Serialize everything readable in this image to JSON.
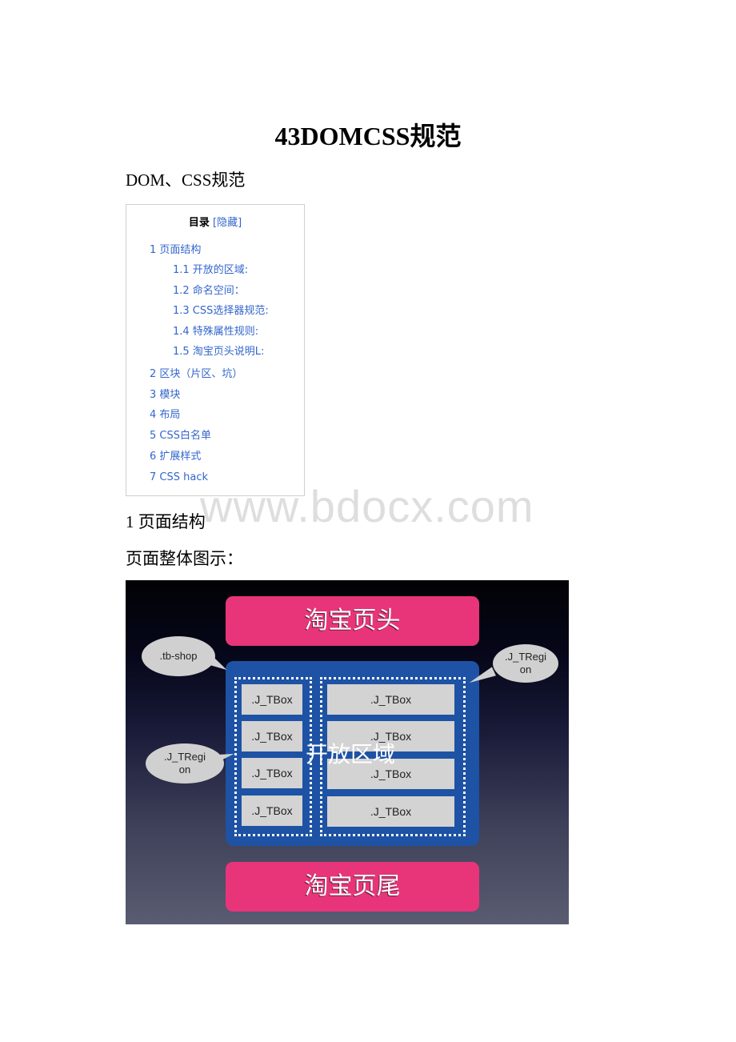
{
  "document": {
    "title": "43DOMCSS规范",
    "subtitle": "DOM、CSS规范"
  },
  "toc": {
    "heading": "目录",
    "toggle_label": "[隐藏]",
    "items": [
      {
        "label": "1 页面结构",
        "level": 1
      },
      {
        "label": "1.1 开放的区域:",
        "level": 2
      },
      {
        "label": "1.2 命名空间：",
        "level": 2
      },
      {
        "label": "1.3 CSS选择器规范:",
        "level": 2
      },
      {
        "label": "1.4 特殊属性规则:",
        "level": 2
      },
      {
        "label": "1.5 淘宝页头说明L:",
        "level": 2
      },
      {
        "label": "2 区块（片区、坑）",
        "level": 1
      },
      {
        "label": "3 模块",
        "level": 1
      },
      {
        "label": "4 布局",
        "level": 1
      },
      {
        "label": "5 CSS白名单",
        "level": 1
      },
      {
        "label": "6 扩展样式",
        "level": 1
      },
      {
        "label": "7 CSS hack",
        "level": 1
      }
    ]
  },
  "watermark": "www.bdocx.com",
  "section": {
    "heading": "1 页面结构",
    "description": "页面整体图示："
  },
  "figure": {
    "header_label": "淘宝页头",
    "footer_label": "淘宝页尾",
    "open_area_label": "开放区域",
    "left_region_boxes": [
      ".J_TBox",
      ".J_TBox",
      ".J_TBox",
      ".J_TBox"
    ],
    "right_region_boxes": [
      ".J_TBox",
      ".J_TBox",
      ".J_TBox",
      ".J_TBox"
    ],
    "callouts": {
      "shop": ".tb-shop",
      "right_region_line1": ".J_TRegi",
      "right_region_line2": "on",
      "left_region_line1": ".J_TRegi",
      "left_region_line2": "on"
    },
    "colors": {
      "pink": "#e8357a",
      "blue": "#1e52a4",
      "box": "#d3d3d3",
      "bubble": "#d0d0d0"
    }
  }
}
